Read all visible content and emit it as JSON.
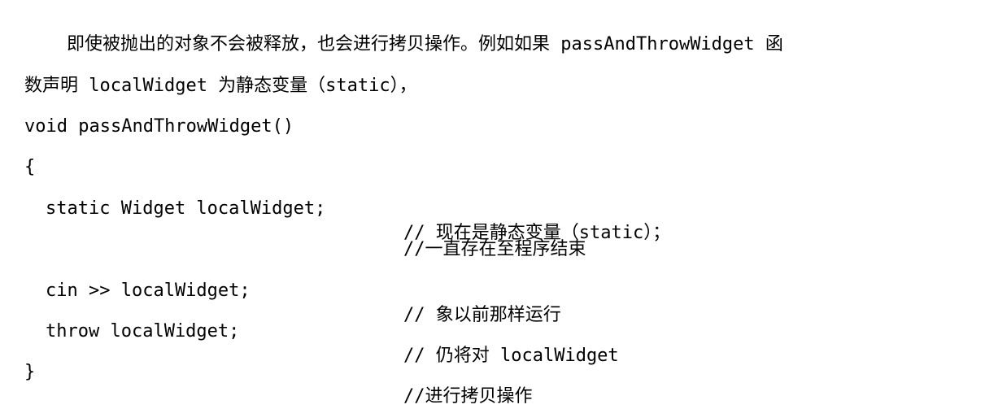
{
  "paragraph": {
    "line1": "即使被抛出的对象不会被释放，也会进行拷贝操作。例如如果 passAndThrowWidget 函",
    "line2": "数声明 localWidget 为静态变量（static），"
  },
  "code": {
    "signature": "void passAndThrowWidget()",
    "open_brace": "{",
    "stmt_static": "static Widget localWidget;",
    "comment_static": "// 现在是静态变量（static）；",
    "comment_until_end": "//一直存在至程序结束",
    "stmt_cin": "cin >> localWidget;",
    "comment_cin": "// 象以前那样运行",
    "stmt_throw": "throw localWidget;",
    "comment_throw": "// 仍将对 localWidget",
    "close_brace": "}",
    "comment_copy": "//进行拷贝操作"
  }
}
